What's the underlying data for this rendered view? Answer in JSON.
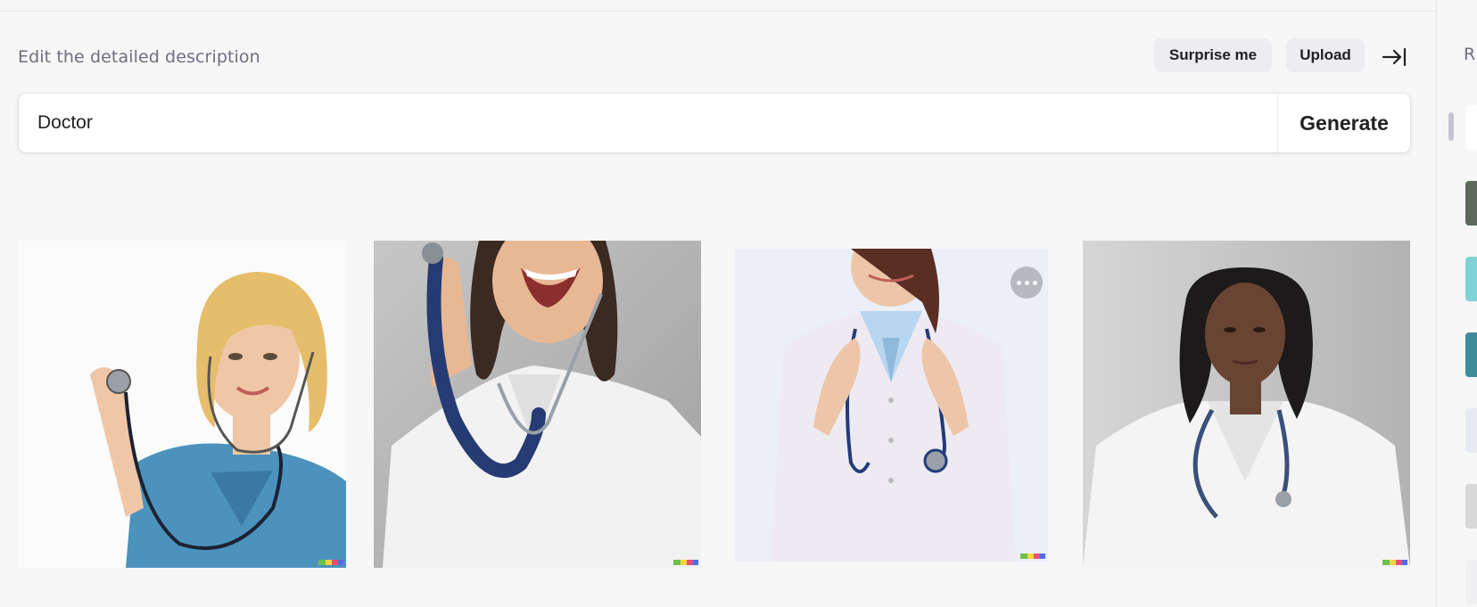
{
  "header": {
    "title": "Edit the detailed description",
    "surprise_label": "Surprise me",
    "upload_label": "Upload"
  },
  "prompt": {
    "value": "Doctor",
    "generate_label": "Generate"
  },
  "results": [
    {
      "name": "result-image-1",
      "description_icon": "image"
    },
    {
      "name": "result-image-2",
      "description_icon": "image"
    },
    {
      "name": "result-image-3",
      "description_icon": "image"
    },
    {
      "name": "result-image-4",
      "description_icon": "image"
    }
  ],
  "history": {
    "label": "R"
  },
  "colors": {
    "background": "#f7f7f8",
    "pill": "#ececf1",
    "text": "#202123",
    "muted": "#6e6e80"
  }
}
